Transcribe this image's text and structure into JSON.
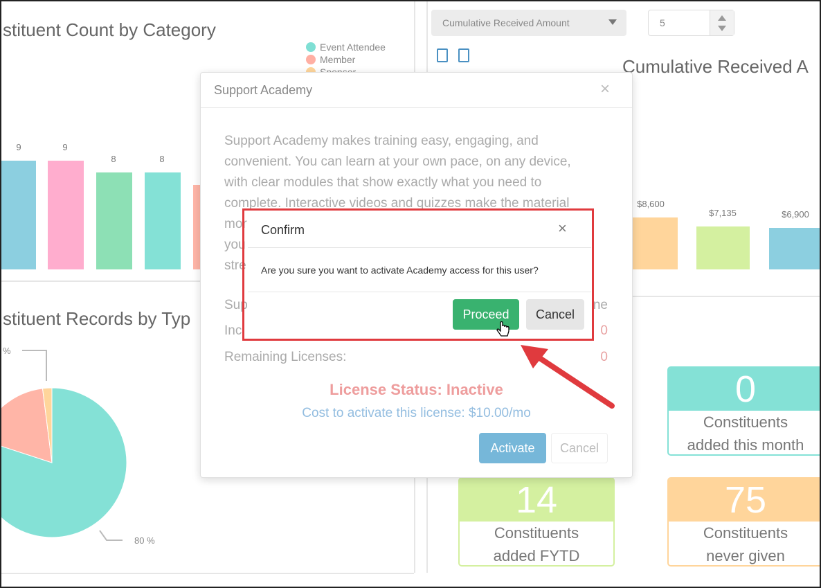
{
  "top_left_chart": {
    "title": "stituent Count by Category",
    "legend": [
      {
        "label": "Event Attendee",
        "color": "#7fdfd4"
      },
      {
        "label": "Member",
        "color": "#ffafa3"
      },
      {
        "label": "Sponsor",
        "color": "#ffd59b"
      }
    ],
    "chart_data": {
      "type": "bar",
      "values": [
        9,
        9,
        8,
        8
      ],
      "colors": [
        "#8ccfe0",
        "#ffadce",
        "#8de0b5",
        "#84e1d6"
      ]
    }
  },
  "right_top": {
    "select_value": "Cumulative Received Amount",
    "number_value": "5",
    "chart_title": "Cumulative Received A",
    "chart_data": {
      "type": "bar",
      "values": [
        8600,
        7135,
        6900
      ],
      "labels": [
        "$8,600",
        "$7,135",
        "$6,900"
      ],
      "colors": [
        "#ffd59b",
        "#d4f0a0",
        "#8ccfe0"
      ]
    }
  },
  "bottom_left": {
    "title": "stituent Records by Typ",
    "pct_top": "%",
    "pct_bottom": "80 %",
    "chart_data": {
      "type": "pie",
      "values": [
        80,
        18,
        2
      ],
      "colors": [
        "#84e1d6",
        "#ffb5a7",
        "#ffd59b"
      ]
    }
  },
  "stats": [
    {
      "value": "0",
      "line1": "Constituents",
      "line2": "added this month",
      "color": "#84e1d6"
    },
    {
      "value": "14",
      "line1": "Constituents",
      "line2": "added FYTD",
      "color": "#d4f0a0"
    },
    {
      "value": "75",
      "line1": "Constituents",
      "line2": "never given",
      "color": "#ffd59b"
    }
  ],
  "support_modal": {
    "title": "Support Academy",
    "close": "×",
    "body_line1": "Support Academy makes training easy, engaging, and",
    "body_line2": "convenient. You can learn at your own pace, on any device,",
    "body_line3": "with clear modules that show exactly what you need to",
    "body_line4": "complete. Interactive videos and quizzes make the material",
    "body_line5": "mor",
    "body_line6": "you",
    "body_line7": "stre",
    "row1_label": "Sup",
    "row1_value": "ne",
    "row2_label": "Inc",
    "row2_value": "0",
    "row3_label": "Remaining Licenses:",
    "row3_value": "0",
    "license_status": "License Status: Inactive",
    "cost": "Cost to activate this license: $10.00/mo",
    "activate": "Activate",
    "cancel": "Cancel"
  },
  "confirm": {
    "title": "Confirm",
    "close": "×",
    "message": "Are you sure you want to activate Academy access for this user?",
    "proceed": "Proceed",
    "cancel": "Cancel"
  }
}
